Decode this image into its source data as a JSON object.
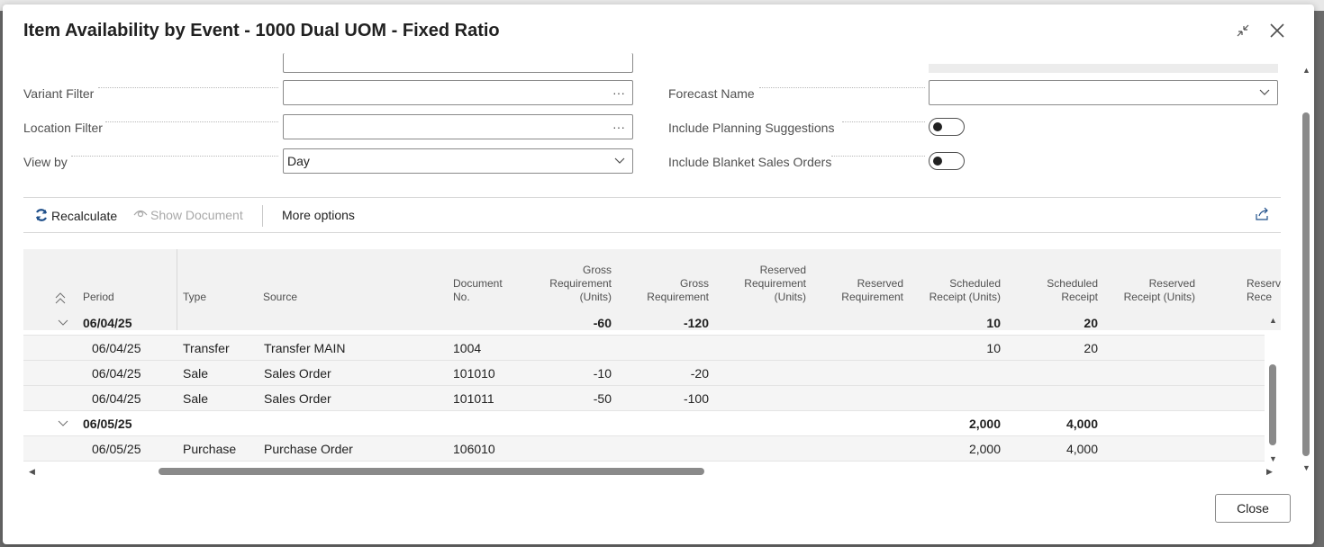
{
  "dialog": {
    "title": "Item Availability by Event - 1000 Dual UOM - Fixed Ratio",
    "close_button": "Close"
  },
  "filters": {
    "variant_filter": {
      "label": "Variant Filter",
      "value": "",
      "suffix": "···"
    },
    "location_filter": {
      "label": "Location Filter",
      "value": "",
      "suffix": "···"
    },
    "view_by": {
      "label": "View by",
      "value": "Day"
    },
    "forecast_name": {
      "label": "Forecast Name",
      "value": ""
    },
    "include_planning_suggestions": {
      "label": "Include Planning Suggestions",
      "checked": false
    },
    "include_blanket_sales_orders": {
      "label": "Include Blanket Sales Orders",
      "checked": false
    }
  },
  "toolbar": {
    "recalculate": "Recalculate",
    "show_document": "Show Document",
    "more_options": "More options"
  },
  "table": {
    "headers": {
      "period": "Period",
      "type": "Type",
      "source": "Source",
      "document_no": "Document\nNo.",
      "gross_req_units": "Gross\nRequirement\n(Units)",
      "gross_req": "Gross\nRequirement",
      "reserved_req_units": "Reserved\nRequirement\n(Units)",
      "reserved_req": "Reserved\nRequirement",
      "sched_receipt_units": "Scheduled\nReceipt (Units)",
      "sched_receipt": "Scheduled\nReceipt",
      "reserved_receipt_units": "Reserved\nReceipt (Units)",
      "reserved_receipt": "Reserv\nRece"
    },
    "groups": [
      {
        "period": "06/04/25",
        "gross_req_units": "-60",
        "gross_req": "-120",
        "sched_receipt_units": "10",
        "sched_receipt": "20"
      },
      {
        "period": "06/05/25",
        "gross_req_units": "",
        "gross_req": "",
        "sched_receipt_units": "2,000",
        "sched_receipt": "4,000"
      }
    ],
    "rows": [
      {
        "period": "06/04/25",
        "type": "Transfer",
        "source": "Transfer MAIN",
        "document_no": "1004",
        "gross_req_units": "",
        "gross_req": "",
        "sched_receipt_units": "10",
        "sched_receipt": "20"
      },
      {
        "period": "06/04/25",
        "type": "Sale",
        "source": "Sales Order",
        "document_no": "101010",
        "gross_req_units": "-10",
        "gross_req": "-20",
        "sched_receipt_units": "",
        "sched_receipt": ""
      },
      {
        "period": "06/04/25",
        "type": "Sale",
        "source": "Sales Order",
        "document_no": "101011",
        "gross_req_units": "-50",
        "gross_req": "-100",
        "sched_receipt_units": "",
        "sched_receipt": ""
      },
      {
        "period": "06/05/25",
        "type": "Purchase",
        "source": "Purchase Order",
        "document_no": "106010",
        "gross_req_units": "",
        "gross_req": "",
        "sched_receipt_units": "2,000",
        "sched_receipt": "4,000"
      }
    ]
  }
}
